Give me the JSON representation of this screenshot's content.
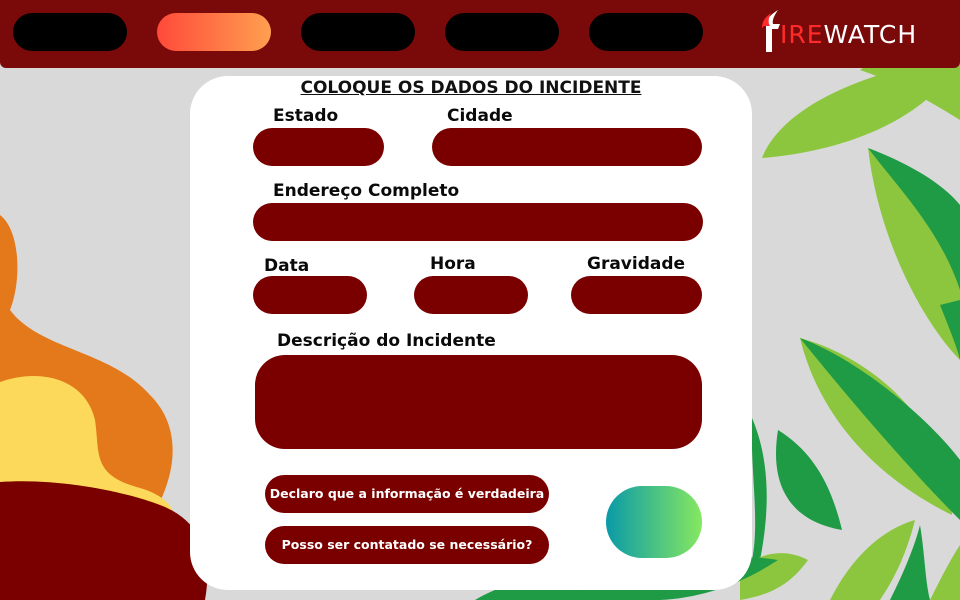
{
  "app": {
    "logo_letter": "F",
    "logo_highlight": "IRE",
    "logo_rest": "WATCH"
  },
  "nav": {
    "items": [
      "",
      "",
      "",
      "",
      ""
    ],
    "active_index": 1
  },
  "form": {
    "title": "COLOQUE OS DADOS DO INCIDENTE",
    "estado_label": "Estado",
    "cidade_label": "Cidade",
    "endereco_label": "Endereço Completo",
    "data_label": "Data",
    "hora_label": "Hora",
    "gravidade_label": "Gravidade",
    "descricao_label": "Descrição do Incidente",
    "declaro_label": "Declaro que a informação é verdadeira",
    "contato_label": "Posso ser contatado se necessário?",
    "values": {
      "estado": "",
      "cidade": "",
      "endereco": "",
      "data": "",
      "hora": "",
      "gravidade": "",
      "descricao": ""
    }
  },
  "colors": {
    "topbar": "#7a0a0a",
    "field": "#7a0000",
    "active_nav_start": "#ff4a3a",
    "active_nav_end": "#ff9f50",
    "submit_start": "#0a9aa8",
    "submit_end": "#86e860"
  }
}
